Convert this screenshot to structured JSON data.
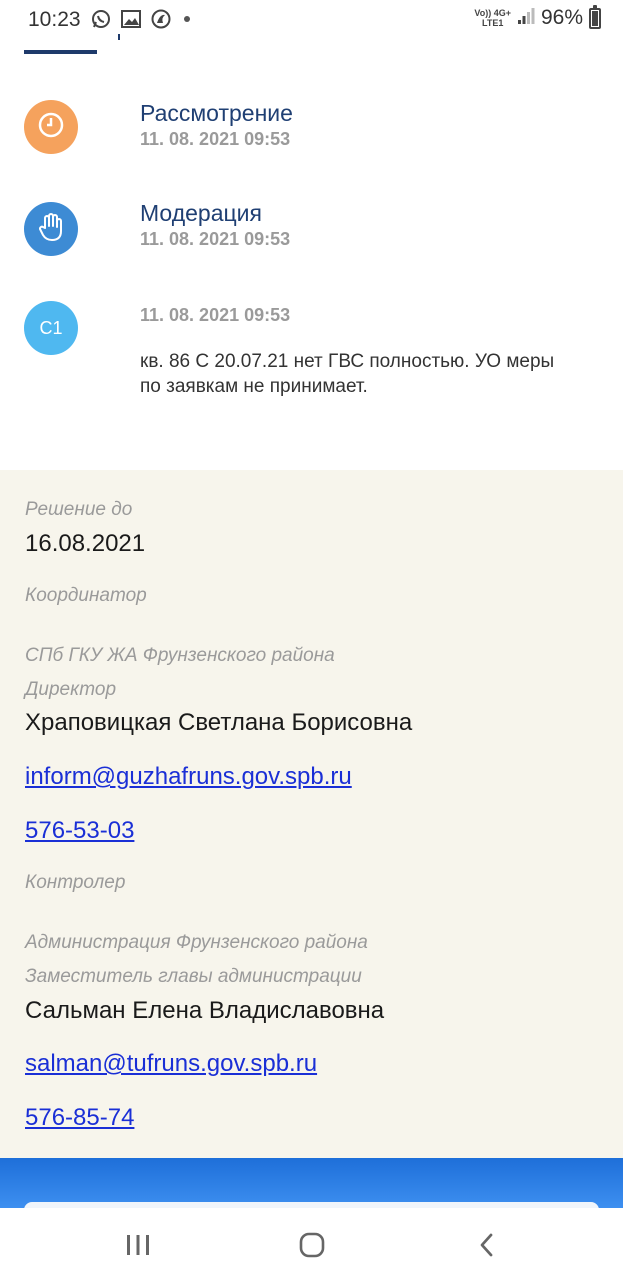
{
  "status_bar": {
    "time": "10:23",
    "network_top": "Vo)) 4G+",
    "network_bottom": "LTE1",
    "battery": "96%",
    "battery_level": 0.96
  },
  "timeline": [
    {
      "icon": "clock-icon",
      "color": "#f5a25d",
      "title": "Рассмотрение",
      "date": "11. 08. 2021 09:53"
    },
    {
      "icon": "hand-icon",
      "color": "#3d8bd4",
      "title": "Модерация",
      "date": "11. 08. 2021 09:53"
    },
    {
      "icon": "avatar",
      "color": "#4fb8f0",
      "badge": "С1",
      "date": "11. 08. 2021 09:53",
      "text": "кв. 86 С 20.07.21 нет ГВС полностью. УО меры по заявкам не принимает."
    }
  ],
  "details": {
    "deadline_label": "Решение до",
    "deadline_value": "16.08.2021",
    "coordinator_label": "Координатор",
    "coordinator_org": "СПб ГКУ ЖА Фрунзенского района",
    "coordinator_role": "Директор",
    "coordinator_name": "Храповицкая Светлана Борисовна",
    "coordinator_email": "inform@guzhafruns.gov.spb.ru",
    "coordinator_phone": "576-53-03",
    "controller_label": "Контролер",
    "controller_org": "Администрация Фрунзенского района",
    "controller_role": "Заместитель главы администрации",
    "controller_name": "Сальман Елена Владиславовна",
    "controller_email": "salman@tufruns.gov.spb.ru",
    "controller_phone": "576-85-74"
  },
  "nav": {
    "recent": "recent-apps-icon",
    "home": "home-icon",
    "back": "back-icon"
  }
}
